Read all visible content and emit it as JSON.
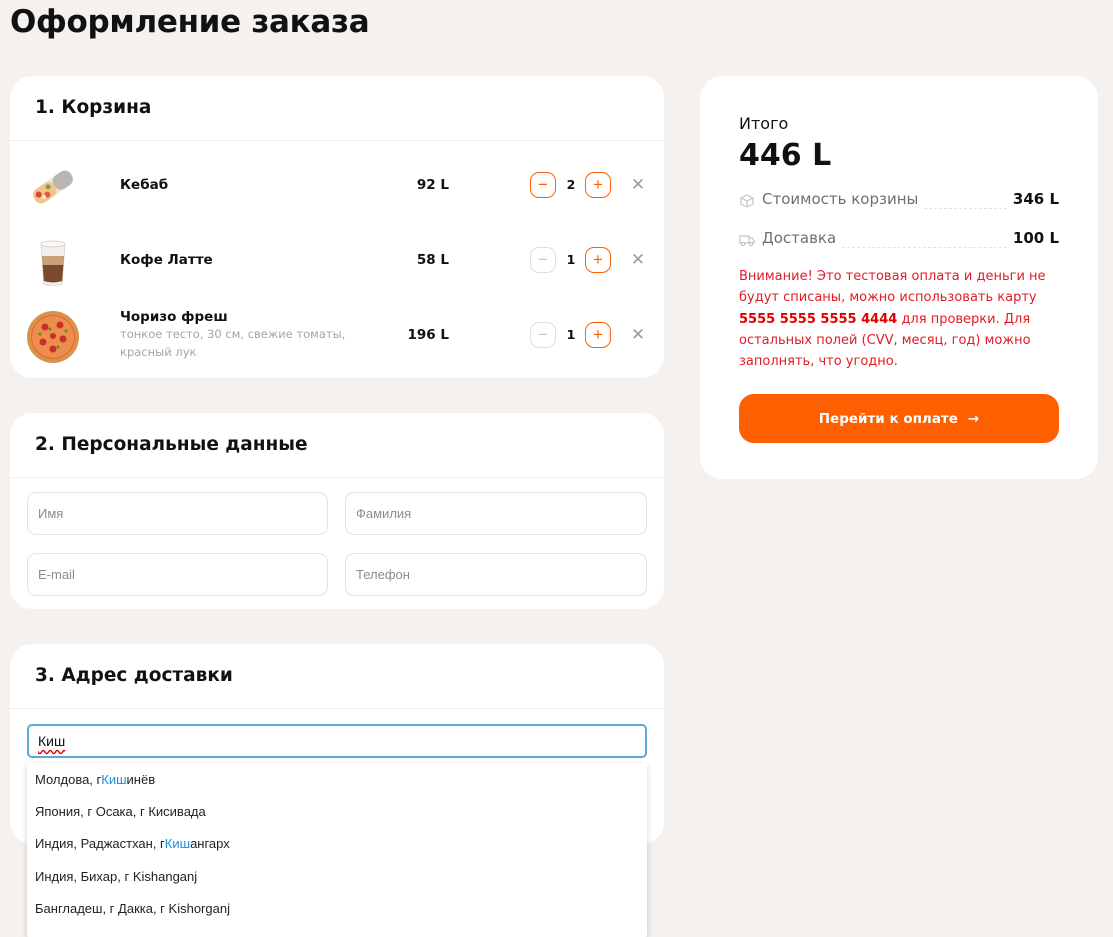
{
  "page": {
    "title": "Оформление заказа"
  },
  "cart": {
    "heading": "1. Корзина",
    "items": [
      {
        "name": "Кебаб",
        "description": "",
        "price": "92 L",
        "qty": "2",
        "image_icon": "kebab-image"
      },
      {
        "name": "Кофе Латте",
        "description": "",
        "price": "58 L",
        "qty": "1",
        "image_icon": "latte-image"
      },
      {
        "name": "Чоризо фреш",
        "description": "тонкое тесто, 30 см, свежие томаты, красный лук",
        "price": "196 L",
        "qty": "1",
        "image_icon": "pizza-image"
      }
    ],
    "minus_symbol": "−",
    "plus_symbol": "+",
    "remove_symbol": "✕"
  },
  "personal": {
    "heading": "2. Персональные данные",
    "first_name_placeholder": "Имя",
    "last_name_placeholder": "Фамилия",
    "email_placeholder": "E-mail",
    "phone_placeholder": "Телефон"
  },
  "address": {
    "heading": "3. Адрес доставки",
    "input_value": "Киш",
    "suggestions": [
      {
        "before": "Молдова, г ",
        "match": "Киш",
        "after": "инёв"
      },
      {
        "before": "Япония, г Осака, г Кисивада",
        "match": "",
        "after": ""
      },
      {
        "before": "Индия, Раджастхан, г ",
        "match": "Киш",
        "after": "ангарх"
      },
      {
        "before": "Индия, Бихар, г Kishanganj",
        "match": "",
        "after": ""
      },
      {
        "before": "Бангладеш, г Дакка, г Kishorganj",
        "match": "",
        "after": ""
      }
    ]
  },
  "summary": {
    "total_label": "Итого",
    "total_value": "446 L",
    "cart_cost_label": "Стоимость корзины",
    "cart_cost_value": "346 L",
    "delivery_label": "Доставка",
    "delivery_value": "100 L",
    "warning_before": "Внимание! Это тестовая оплата и деньги не будут списаны, можно использовать карту ",
    "warning_card": "5555 5555 5555 4444",
    "warning_after": " для проверки. Для остальных полей (CVV, месяц, год) можно заполнять, что угодно.",
    "pay_button_label": "Перейти к оплате",
    "pay_arrow": "→"
  },
  "colors": {
    "accent": "#fe5f00",
    "warning": "#e21c25",
    "background": "#f4f1ee",
    "highlight": "#1a8fe0"
  }
}
